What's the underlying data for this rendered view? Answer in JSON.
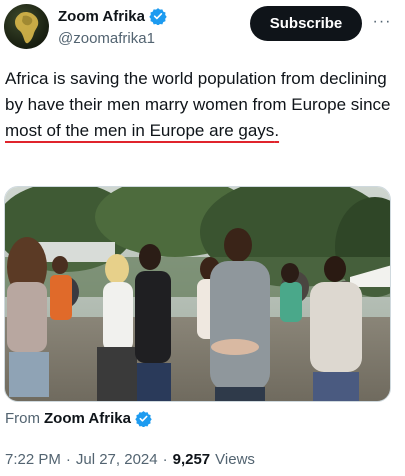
{
  "author": {
    "display_name": "Zoom Afrika",
    "handle": "@zoomafrika1",
    "verified_icon": "verified-badge-icon",
    "accent": "#1d9bf0"
  },
  "actions": {
    "subscribe_label": "Subscribe",
    "more_label": "···"
  },
  "tweet": {
    "text_part1": "Africa is saving the world population from declining by have their men marry women from Europe since ",
    "text_underlined": "most of the men in Europe are gays",
    "text_part3": ".",
    "underline_color": "#e0242c"
  },
  "media": {
    "type": "video-thumbnail",
    "description_icon": "video-frame-icon"
  },
  "source": {
    "prefix": "From",
    "name": "Zoom Afrika"
  },
  "meta": {
    "time": "7:22 PM",
    "separator": "·",
    "date": "Jul 27, 2024",
    "views_count": "9,257",
    "views_label": "Views"
  }
}
